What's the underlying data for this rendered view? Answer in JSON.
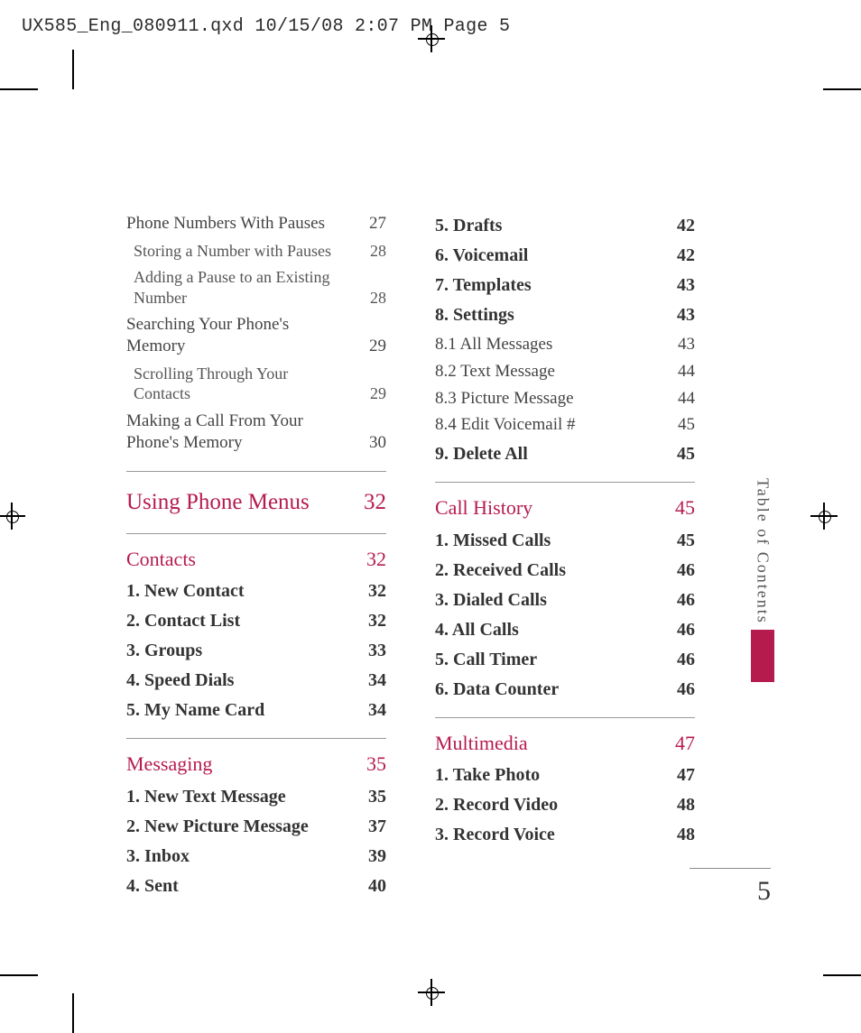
{
  "slug": "UX585_Eng_080911.qxd  10/15/08  2:07 PM  Page 5",
  "side_tab": "Table of Contents",
  "page_number": "5",
  "left_column": {
    "pre": [
      {
        "label": "Phone Numbers With Pauses",
        "page": "27",
        "lvl": "l0"
      },
      {
        "label": "Storing a Number with Pauses",
        "page": "28",
        "lvl": "l1"
      },
      {
        "label": "Adding a Pause to an Existing Number",
        "page": "28",
        "lvl": "l1"
      },
      {
        "label": "Searching Your Phone's Memory",
        "page": "29",
        "lvl": "l0"
      },
      {
        "label": "Scrolling Through Your Contacts",
        "page": "29",
        "lvl": "l1"
      },
      {
        "label": "Making a Call From Your Phone's Memory",
        "page": "30",
        "lvl": "l0"
      }
    ],
    "big_section": {
      "label": "Using Phone Menus",
      "page": "32"
    },
    "sections": [
      {
        "title": "Contacts",
        "page": "32",
        "items": [
          {
            "label": "1. New Contact",
            "page": "32"
          },
          {
            "label": "2. Contact List",
            "page": "32"
          },
          {
            "label": "3. Groups",
            "page": "33"
          },
          {
            "label": "4. Speed Dials",
            "page": "34"
          },
          {
            "label": "5. My Name Card",
            "page": "34"
          }
        ]
      },
      {
        "title": "Messaging",
        "page": "35",
        "items": [
          {
            "label": "1. New Text Message",
            "page": "35"
          },
          {
            "label": "2. New Picture Message",
            "page": "37"
          },
          {
            "label": "3. Inbox",
            "page": "39"
          },
          {
            "label": "4. Sent",
            "page": "40"
          }
        ]
      }
    ]
  },
  "right_column": {
    "pre_items": [
      {
        "label": "5. Drafts",
        "page": "42",
        "lvl": "l2"
      },
      {
        "label": "6. Voicemail",
        "page": "42",
        "lvl": "l2"
      },
      {
        "label": "7. Templates",
        "page": "43",
        "lvl": "l2"
      },
      {
        "label": "8. Settings",
        "page": "43",
        "lvl": "l2"
      },
      {
        "label": "8.1 All Messages",
        "page": "43",
        "lvl": "l0"
      },
      {
        "label": "8.2 Text Message",
        "page": "44",
        "lvl": "l0"
      },
      {
        "label": "8.3 Picture Message",
        "page": "44",
        "lvl": "l0"
      },
      {
        "label": "8.4 Edit Voicemail #",
        "page": "45",
        "lvl": "l0"
      },
      {
        "label": "9. Delete All",
        "page": "45",
        "lvl": "l2"
      }
    ],
    "sections": [
      {
        "title": "Call History",
        "page": "45",
        "items": [
          {
            "label": "1. Missed Calls",
            "page": "45"
          },
          {
            "label": "2. Received Calls",
            "page": "46"
          },
          {
            "label": "3. Dialed Calls",
            "page": "46"
          },
          {
            "label": "4. All Calls",
            "page": "46"
          },
          {
            "label": "5. Call Timer",
            "page": "46"
          },
          {
            "label": "6. Data Counter",
            "page": "46"
          }
        ]
      },
      {
        "title": "Multimedia",
        "page": "47",
        "items": [
          {
            "label": "1. Take Photo",
            "page": "47"
          },
          {
            "label": "2. Record Video",
            "page": "48"
          },
          {
            "label": "3. Record Voice",
            "page": "48"
          }
        ]
      }
    ]
  }
}
